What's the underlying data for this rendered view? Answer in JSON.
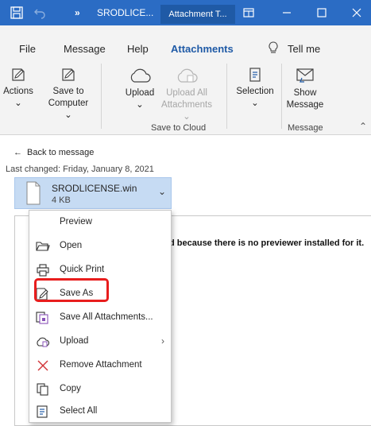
{
  "titlebar": {
    "breadcrumb_chevron": "»",
    "doc_title": "SRODLICE...",
    "active_tab": "Attachment T...",
    "window_controls": [
      "minimize-icon",
      "maximize-icon",
      "close-icon"
    ]
  },
  "menu_tabs": [
    "File",
    "Message",
    "Help",
    "Attachments",
    "Tell me"
  ],
  "ribbon": {
    "actions": {
      "label": "Actions"
    },
    "save_to_computer": {
      "label1": "Save to",
      "label2": "Computer"
    },
    "upload": {
      "label": "Upload"
    },
    "upload_all": {
      "label1": "Upload All",
      "label2": "Attachments"
    },
    "selection": {
      "label": "Selection"
    },
    "show_message": {
      "label1": "Show",
      "label2": "Message"
    },
    "groups": {
      "save_to_cloud": "Save to Cloud",
      "message": "Message"
    }
  },
  "content": {
    "back_label": "Back to message",
    "last_changed": "Last changed:  Friday, January 8, 2021",
    "attachment": {
      "name": "SRODLICENSE.win",
      "size": "4 KB"
    },
    "preview_message": "d because there is no previewer installed for it."
  },
  "context_menu": [
    {
      "label": "Preview",
      "icon": "none"
    },
    {
      "label": "Open",
      "icon": "folder-open-icon"
    },
    {
      "label": "Quick Print",
      "icon": "printer-icon"
    },
    {
      "label": "Save As",
      "icon": "save-as-icon"
    },
    {
      "label": "Save All Attachments...",
      "icon": "save-all-icon"
    },
    {
      "label": "Upload",
      "icon": "upload-icon",
      "has_submenu": true
    },
    {
      "label": "Remove Attachment",
      "icon": "remove-icon"
    },
    {
      "label": "Copy",
      "icon": "copy-icon"
    },
    {
      "label": "Select All",
      "icon": "select-all-icon"
    }
  ],
  "colors": {
    "titlebar": "#2b6cc4",
    "accent": "#1f5aa6",
    "attachment_bg": "#c6dbf3",
    "highlight": "#e81d1d",
    "remove_icon": "#d13438"
  }
}
